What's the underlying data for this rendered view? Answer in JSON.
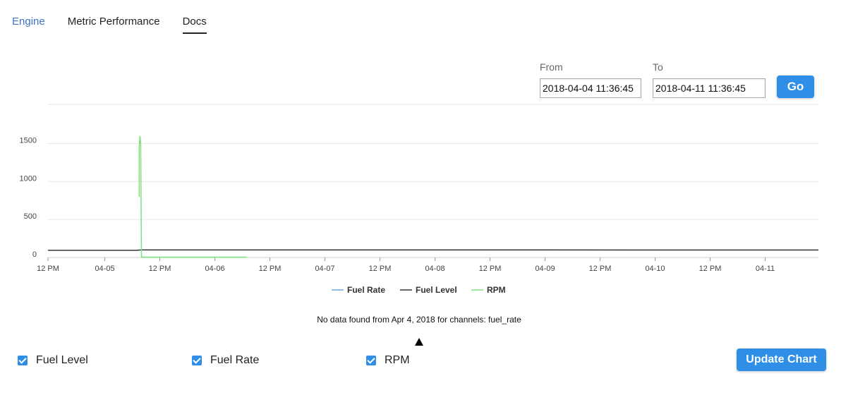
{
  "tabs": [
    {
      "label": "Engine",
      "active": false
    },
    {
      "label": "Metric Performance",
      "active": false
    },
    {
      "label": "Docs",
      "active": true
    }
  ],
  "range": {
    "from_label": "From",
    "from_value": "2018-04-04 11:36:45",
    "to_label": "To",
    "to_value": "2018-04-11 11:36:45",
    "go_label": "Go"
  },
  "chart_data": {
    "type": "line",
    "y_ticks": [
      0,
      500,
      1000,
      1500
    ],
    "ylim": [
      0,
      1650
    ],
    "x_ticks": [
      "12 PM",
      "04-05",
      "12 PM",
      "04-06",
      "12 PM",
      "04-07",
      "12 PM",
      "04-08",
      "12 PM",
      "04-09",
      "12 PM",
      "04-10",
      "12 PM",
      "04-11"
    ],
    "x_tick_hours": [
      12,
      24,
      36,
      48,
      60,
      72,
      84,
      96,
      108,
      120,
      132,
      144,
      156,
      168
    ],
    "x_start": "2018-04-04 11:36:45",
    "x_end": "2018-04-11 11:36:45",
    "grid": true,
    "legend_position": "bottom",
    "series": [
      {
        "name": "Fuel Rate",
        "color": "#6ea6e0",
        "points": []
      },
      {
        "name": "Fuel Level",
        "color": "#333333",
        "points": [
          {
            "x": "2018-04-04 11:36",
            "y": 95
          },
          {
            "x": "2018-04-05 07:00",
            "y": 95
          },
          {
            "x": "2018-04-05 08:00",
            "y": 100
          },
          {
            "x": "2018-04-06 07:00",
            "y": 100
          },
          {
            "x": "2018-04-11 11:36",
            "y": 98
          }
        ]
      },
      {
        "name": "RPM",
        "color": "#7fe27f",
        "points": [
          {
            "x": "2018-04-05 07:30",
            "y": 800
          },
          {
            "x": "2018-04-05 07:30",
            "y": 1450
          },
          {
            "x": "2018-04-05 07:40",
            "y": 1600
          },
          {
            "x": "2018-04-05 07:50",
            "y": 1500
          },
          {
            "x": "2018-04-05 08:00",
            "y": 5
          },
          {
            "x": "2018-04-06 07:00",
            "y": 5
          }
        ]
      }
    ]
  },
  "message": "No data found from Apr 4, 2018 for channels: fuel_rate",
  "channels": [
    {
      "label": "Fuel Level",
      "checked": true
    },
    {
      "label": "Fuel Rate",
      "checked": true
    },
    {
      "label": "RPM",
      "checked": true
    }
  ],
  "update_label": "Update Chart"
}
